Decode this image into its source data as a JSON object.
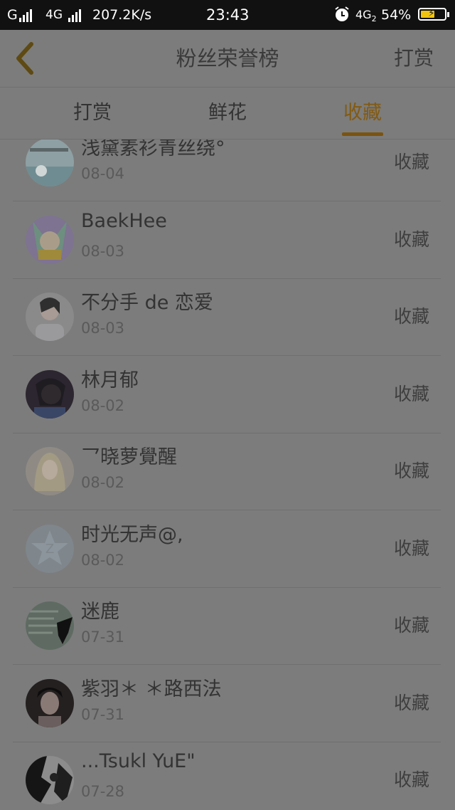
{
  "status_bar": {
    "carrier": "G",
    "network": "4G",
    "speed": "207.2K/s",
    "time": "23:43",
    "network2": "4G",
    "network2_sub": "2",
    "battery": "54%"
  },
  "header": {
    "title": "粉丝荣誉榜",
    "right_action": "打赏"
  },
  "tabs": [
    {
      "label": "打赏",
      "active": false
    },
    {
      "label": "鲜花",
      "active": false
    },
    {
      "label": "收藏",
      "active": true
    }
  ],
  "fans": [
    {
      "name": "浅黛素衫青丝绕°",
      "date": "08-04",
      "action": "收藏"
    },
    {
      "name": "BaekHee",
      "date": "08-03",
      "action": "收藏"
    },
    {
      "name": "不分手 de 恋爱",
      "date": "08-03",
      "action": "收藏"
    },
    {
      "name": "林月郁",
      "date": "08-02",
      "action": "收藏"
    },
    {
      "name": "乛晓萝覺醒",
      "date": "08-02",
      "action": "收藏"
    },
    {
      "name": "时光无声@,",
      "date": "08-02",
      "action": "收藏"
    },
    {
      "name": "迷鹿",
      "date": "07-31",
      "action": "收藏"
    },
    {
      "name": "紫羽＊ ＊路西法",
      "date": "07-31",
      "action": "收藏"
    },
    {
      "name": "...Tsukl YuE\"",
      "date": "07-28",
      "action": "收藏"
    }
  ],
  "colors": {
    "overlay_bg": "#7c7c7c",
    "accent": "#825a12",
    "status_bar": "#111111"
  }
}
